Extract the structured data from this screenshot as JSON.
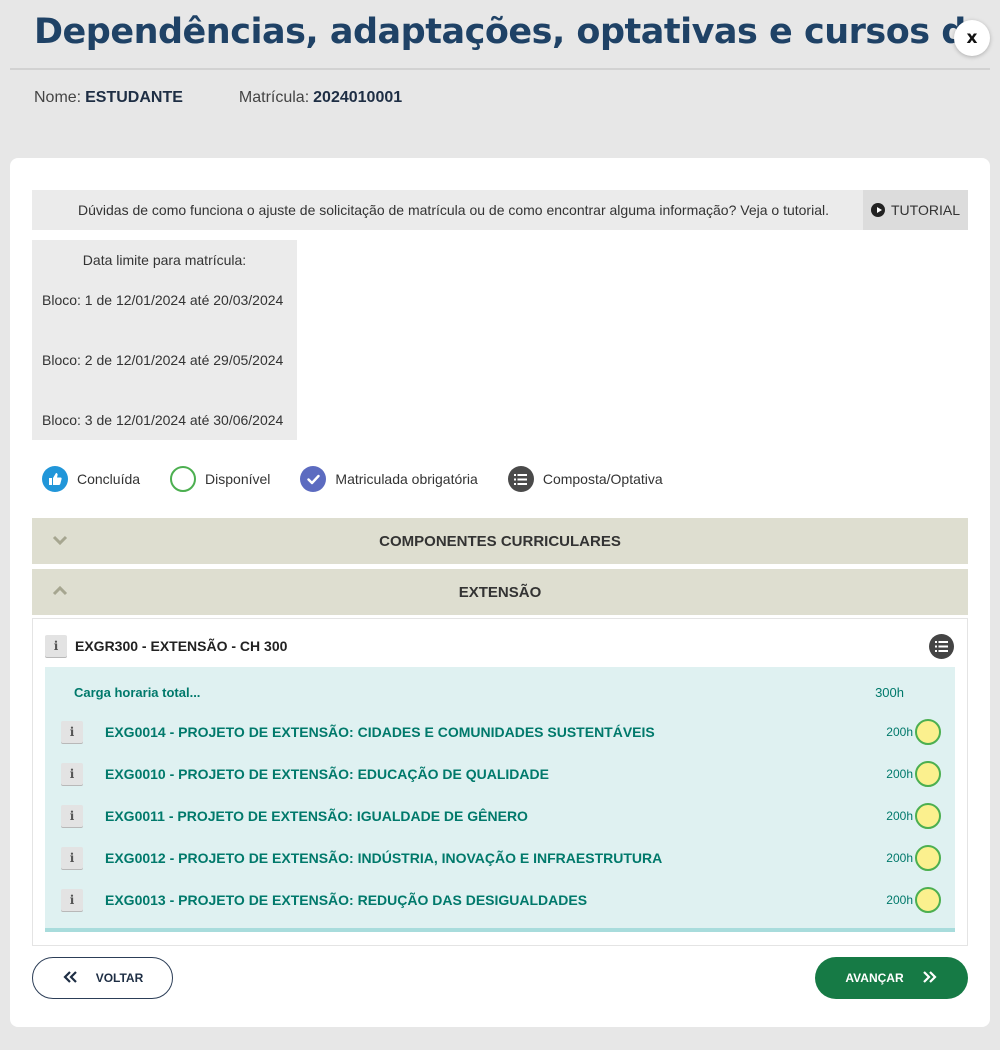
{
  "header": {
    "title": "Dependências, adaptações, optativas e cursos de extensão",
    "close_label": "x"
  },
  "student": {
    "name_label": "Nome:",
    "name_value": "ESTUDANTE",
    "registration_label": "Matrícula:",
    "registration_value": "2024010001"
  },
  "tutorial": {
    "text": "Dúvidas de como funciona o ajuste de solicitação de matrícula ou de como encontrar alguma informação? Veja o tutorial.",
    "button_label": "TUTORIAL",
    "icon": "play-circle-icon"
  },
  "deadline": {
    "title": "Data limite para matrícula:",
    "blocks": [
      "Bloco: 1 de 12/01/2024 até 20/03/2024",
      "Bloco: 2 de 12/01/2024 até 29/05/2024",
      "Bloco: 3 de 12/01/2024 até 30/06/2024"
    ]
  },
  "legend": [
    {
      "label": "Concluída",
      "icon": "thumbs-up-icon",
      "color": "#2196d9"
    },
    {
      "label": "Disponível",
      "icon": "empty-circle-icon",
      "color": "#4caf50"
    },
    {
      "label": "Matriculada obrigatória",
      "icon": "check-icon",
      "color": "#5c6bc0"
    },
    {
      "label": "Composta/Optativa",
      "icon": "list-icon",
      "color": "#4a4a4a"
    }
  ],
  "accordion": [
    {
      "label": "COMPONENTES CURRICULARES",
      "expanded": false
    },
    {
      "label": "EXTENSÃO",
      "expanded": true
    }
  ],
  "extension": {
    "group_label": "EXGR300 - EXTENSÃO - CH 300",
    "total_label": "Carga horaria total...",
    "total_hours": "300h",
    "courses": [
      {
        "name": "EXG0014 - PROJETO DE EXTENSÃO: CIDADES E COMUNIDADES SUSTENTÁVEIS",
        "hours": "200h"
      },
      {
        "name": "EXG0010 - PROJETO DE EXTENSÃO: EDUCAÇÃO DE QUALIDADE",
        "hours": "200h"
      },
      {
        "name": "EXG0011 - PROJETO DE EXTENSÃO: IGUALDADE DE GÊNERO",
        "hours": "200h"
      },
      {
        "name": "EXG0012 - PROJETO DE EXTENSÃO: INDÚSTRIA, INOVAÇÃO E INFRAESTRUTURA",
        "hours": "200h"
      },
      {
        "name": "EXG0013 - PROJETO DE EXTENSÃO: REDUÇÃO DAS DESIGUALDADES",
        "hours": "200h"
      }
    ]
  },
  "footer": {
    "back_label": "VOLTAR",
    "next_label": "AVANÇAR"
  },
  "colors": {
    "title": "#1f4266",
    "accent_green": "#167a45",
    "teal_text": "#00796b",
    "panel_bg": "#dff1f1"
  }
}
